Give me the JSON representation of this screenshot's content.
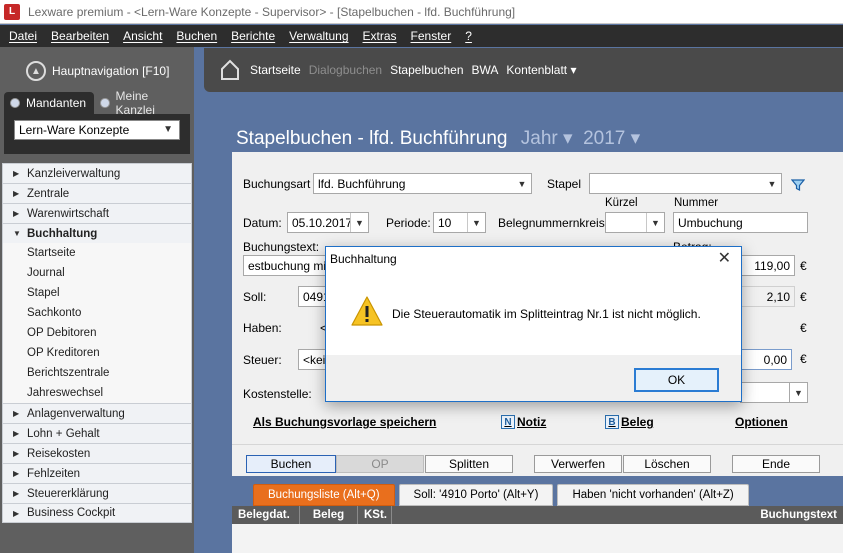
{
  "window": {
    "title": "Lexware premium - <Lern-Ware Konzepte - Supervisor> - [Stapelbuchen - lfd. Buchführung]"
  },
  "menu": [
    "Datei",
    "Bearbeiten",
    "Ansicht",
    "Buchen",
    "Berichte",
    "Verwaltung",
    "Extras",
    "Fenster",
    "?"
  ],
  "sidebar": {
    "hauptnavigation": "Hauptnavigation [F10]",
    "tabs": [
      "Mandanten",
      "Meine Kanzlei"
    ],
    "mandant_value": "Lern-Ware Konzepte",
    "nav": [
      "Kanzleiverwaltung",
      "Zentrale",
      "Warenwirtschaft",
      "Buchhaltung",
      "Startseite",
      "Journal",
      "Stapel",
      "Sachkonto",
      "OP Debitoren",
      "OP Kreditoren",
      "Berichtszentrale",
      "Jahreswechsel",
      "Anlagenverwaltung",
      "Lohn + Gehalt",
      "Reisekosten",
      "Fehlzeiten",
      "Steuererklärung",
      "Business Cockpit"
    ]
  },
  "toolbar": {
    "items": [
      "Startseite",
      "Dialogbuchen",
      "Stapelbuchen",
      "BWA",
      "Kontenblatt ▾"
    ]
  },
  "page": {
    "title": "Stapelbuchen - lfd. Buchführung",
    "jahr_label": "Jahr",
    "jahr_value": "2017"
  },
  "form": {
    "buchungsart_label": "Buchungsart",
    "buchungsart_value": "lfd. Buchführung",
    "stapel_label": "Stapel",
    "stapel_value": "",
    "kuerzel_label": "Kürzel",
    "nummer_label": "Nummer",
    "datum_label": "Datum:",
    "datum_value": "05.10.2017",
    "periode_label": "Periode:",
    "periode_value": "10",
    "belegkreis_label": "Belegnummernkreis:",
    "kuerzel_value": "",
    "nummer_value": "Umbuchung",
    "buchungstext_label": "Buchungstext:",
    "buchungstext_value": "estbuchung mi",
    "betrag_label": "Betrag:",
    "betrag_value": "119,00",
    "soll_label": "Soll:",
    "soll_value": "0491",
    "soll_amount": "2,10",
    "haben_label": "Haben:",
    "haben_value": "<",
    "steuer_label": "Steuer:",
    "steuer_value": "<kei",
    "steuer_amount": "0,00",
    "kostenstelle_label": "Kostenstelle:",
    "currency": "€",
    "link_vorlage": "Als Buchungsvorlage speichern",
    "link_notiz": "Notiz",
    "link_beleg": "Beleg",
    "link_optionen": "Optionen",
    "notiz_icon_letter": "N",
    "beleg_icon_letter": "B"
  },
  "buttons": {
    "buchen": "Buchen",
    "op": "OP",
    "splitten": "Splitten",
    "verwerfen": "Verwerfen",
    "loeschen": "Löschen",
    "ende": "Ende"
  },
  "bottom_tabs": [
    "Buchungsliste (Alt+Q)",
    "Soll: '4910 Porto' (Alt+Y)",
    "Haben 'nicht vorhanden' (Alt+Z)"
  ],
  "grid_columns": [
    "Belegdat.",
    "Beleg",
    "KSt.",
    "Buchungstext"
  ],
  "dialog": {
    "title": "Buchhaltung",
    "message": "Die Steuerautomatik im Splitteintrag Nr.1 ist nicht möglich.",
    "ok": "OK"
  }
}
